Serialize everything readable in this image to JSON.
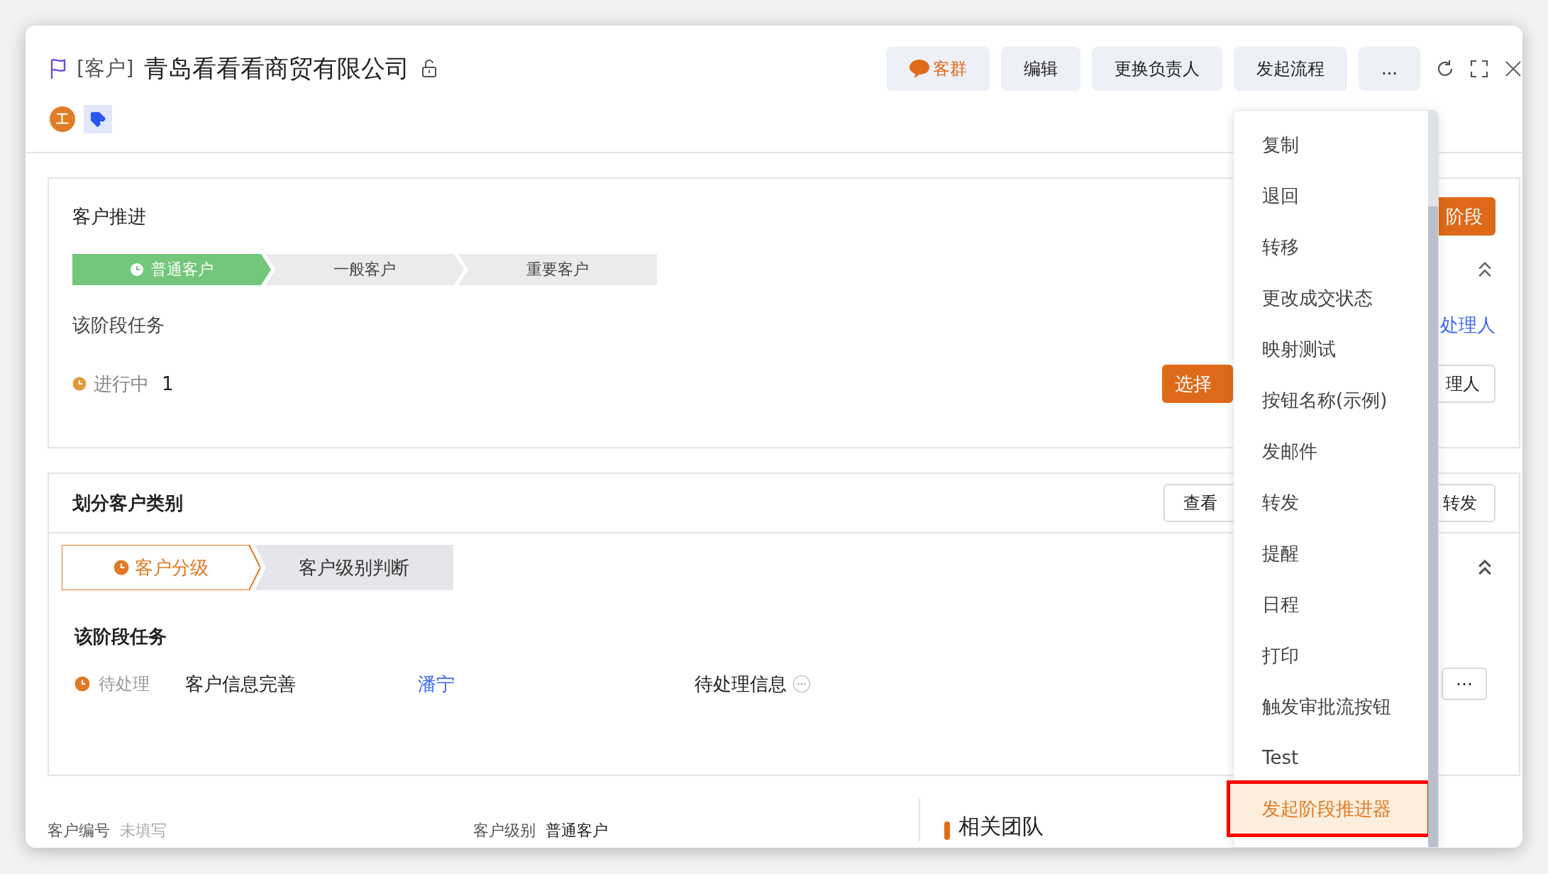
{
  "window": {
    "record_type": "[客户]",
    "title": "青岛看看看商贸有限公司",
    "owner_badge": "工"
  },
  "header_buttons": [
    {
      "label": "客群",
      "kind": "chat"
    },
    {
      "label": "编辑",
      "kind": "plain"
    },
    {
      "label": "更换负责人",
      "kind": "plain"
    },
    {
      "label": "发起流程",
      "kind": "plain"
    },
    {
      "label": "...",
      "kind": "plain"
    }
  ],
  "progress_card": {
    "title": "客户推进",
    "action_button": "阶段",
    "expanded": true,
    "stages": [
      {
        "label": "普通客户",
        "selected": true
      },
      {
        "label": "一般客户",
        "selected": false
      },
      {
        "label": "重要客户",
        "selected": false
      }
    ],
    "task_heading": "该阶段任务",
    "assign_link": "处理人",
    "task_status": "进行中",
    "task_count": "1",
    "choose_button": "选择",
    "assignee_button": "理人"
  },
  "category_card": {
    "title": "划分客户类别",
    "header_buttons": [
      "查看",
      "转发"
    ],
    "expanded": true,
    "stages": [
      {
        "label": "客户分级",
        "selected": true
      },
      {
        "label": "客户级别判断",
        "selected": false
      }
    ],
    "task_heading": "该阶段任务",
    "tasks": [
      {
        "status": "待处理",
        "name": "客户信息完善",
        "assignee": "潘宁",
        "info": "待处理信息"
      }
    ],
    "more_button": "⋯"
  },
  "fields": [
    {
      "label": "客户编号",
      "value": "未填写",
      "empty": true
    },
    {
      "label": "客户级别",
      "value": "普通客户",
      "empty": false
    }
  ],
  "team_section": {
    "title": "相关团队"
  },
  "menu": {
    "items": [
      {
        "label": "复制",
        "selected": false,
        "annotated": false
      },
      {
        "label": "退回",
        "selected": false,
        "annotated": false
      },
      {
        "label": "转移",
        "selected": false,
        "annotated": false
      },
      {
        "label": "更改成交状态",
        "selected": false,
        "annotated": false
      },
      {
        "label": "映射测试",
        "selected": false,
        "annotated": false
      },
      {
        "label": "按钮名称(示例)",
        "selected": false,
        "annotated": false
      },
      {
        "label": "发邮件",
        "selected": false,
        "annotated": false
      },
      {
        "label": "转发",
        "selected": false,
        "annotated": false
      },
      {
        "label": "提醒",
        "selected": false,
        "annotated": false
      },
      {
        "label": "日程",
        "selected": false,
        "annotated": false
      },
      {
        "label": "打印",
        "selected": false,
        "annotated": false
      },
      {
        "label": "触发审批流按钮",
        "selected": false,
        "annotated": false
      },
      {
        "label": "Test",
        "selected": false,
        "annotated": false
      },
      {
        "label": "发起阶段推进器",
        "selected": true,
        "annotated": true
      }
    ]
  }
}
